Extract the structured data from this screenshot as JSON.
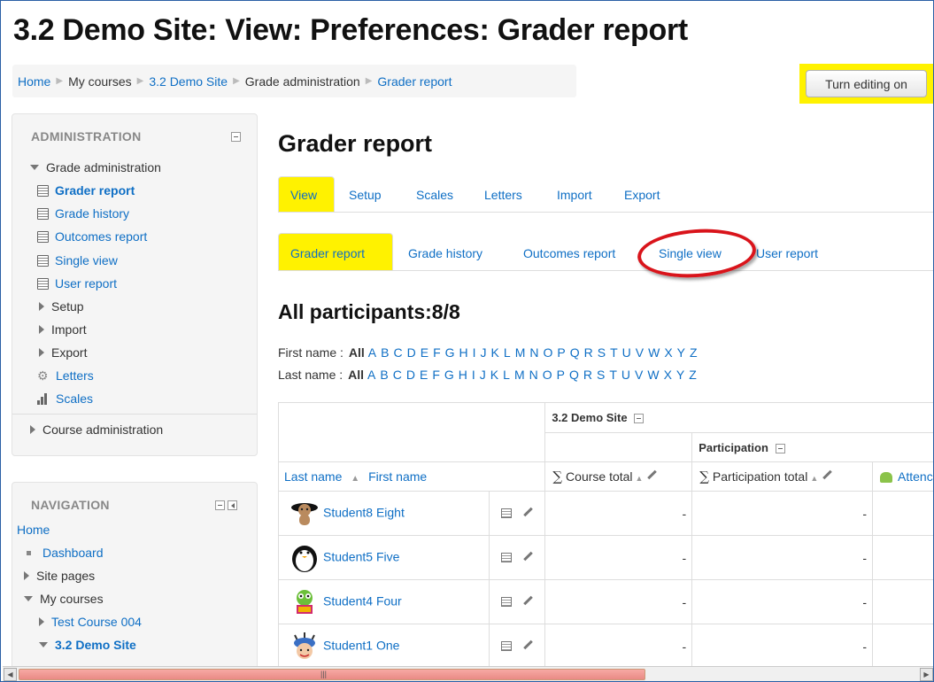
{
  "page_title": "3.2 Demo Site: View: Preferences: Grader report",
  "breadcrumb": [
    "Home",
    "My courses",
    "3.2 Demo Site",
    "Grade administration",
    "Grader report"
  ],
  "edit_button": "Turn editing on",
  "admin_block": {
    "title": "ADMINISTRATION",
    "section": "Grade administration",
    "items": [
      "Grader report",
      "Grade history",
      "Outcomes report",
      "Single view",
      "User report"
    ],
    "collapsed": [
      "Setup",
      "Import",
      "Export"
    ],
    "letters": "Letters",
    "scales": "Scales",
    "course_admin": "Course administration"
  },
  "nav_block": {
    "title": "NAVIGATION",
    "home": "Home",
    "dashboard": "Dashboard",
    "site_pages": "Site pages",
    "my_courses": "My courses",
    "course1": "Test Course 004",
    "course2": "3.2 Demo Site"
  },
  "main": {
    "heading": "Grader report",
    "tabs": [
      "View",
      "Setup",
      "Scales",
      "Letters",
      "Import",
      "Export"
    ],
    "subtabs": [
      "Grader report",
      "Grade history",
      "Outcomes report",
      "Single view",
      "User report"
    ],
    "participants": "All participants:8/8",
    "first_name_label": "First name :",
    "last_name_label": "Last name :",
    "all": "All",
    "letters": [
      "A",
      "B",
      "C",
      "D",
      "E",
      "F",
      "G",
      "H",
      "I",
      "J",
      "K",
      "L",
      "M",
      "N",
      "O",
      "P",
      "Q",
      "R",
      "S",
      "T",
      "U",
      "V",
      "W",
      "X",
      "Y",
      "Z"
    ]
  },
  "grid": {
    "course": "3.2 Demo Site",
    "category": "Participation",
    "col_last": "Last name",
    "col_first": "First name",
    "col_course_total": "Course total",
    "col_part_total": "Participation total",
    "col_atten": "Attenc",
    "dash": "-",
    "students": [
      "Student8 Eight",
      "Student5 Five",
      "Student4 Four",
      "Student1 One"
    ]
  },
  "colors": {
    "highlight": "#fff200",
    "link": "#0f6fc5",
    "annotation": "#d9141b"
  }
}
